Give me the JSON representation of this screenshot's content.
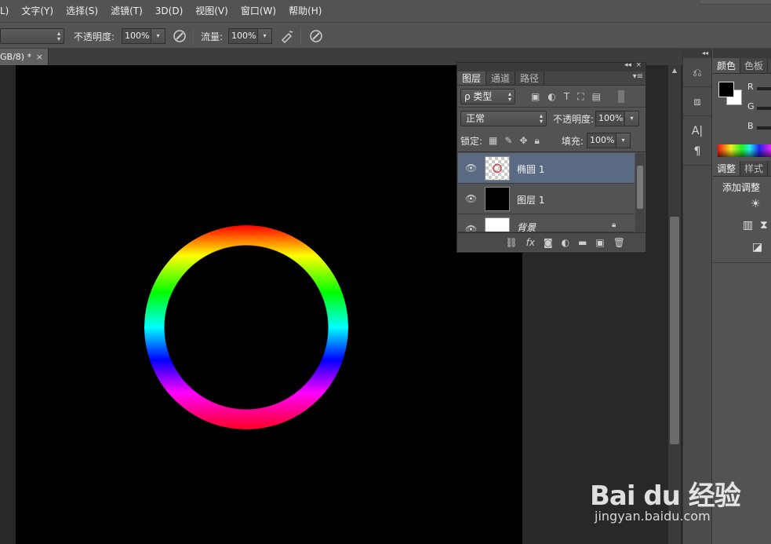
{
  "menu": {
    "items": [
      "L)",
      "文字(Y)",
      "选择(S)",
      "滤镜(T)",
      "3D(D)",
      "视图(V)",
      "窗口(W)",
      "帮助(H)"
    ]
  },
  "options_bar": {
    "opacity_label": "不透明度:",
    "opacity_value": "100%",
    "flow_label": "流量:",
    "flow_value": "100%"
  },
  "document": {
    "tab_title": "GB/8) *",
    "close_glyph": "×"
  },
  "layers_panel": {
    "collapse_glyph": "◂◂",
    "close_glyph": "×",
    "tabs": [
      "图层",
      "通道",
      "路径"
    ],
    "active_tab": "图层",
    "filter_label": "ρ 类型",
    "blend_mode": "正常",
    "opacity_label": "不透明度:",
    "opacity_value": "100%",
    "lock_label": "锁定:",
    "fill_label": "填充:",
    "fill_value": "100%",
    "layers": [
      {
        "name": "椭圆 1",
        "selected": true
      },
      {
        "name": "图层 1",
        "selected": false
      },
      {
        "name": "背景",
        "selected": false
      }
    ],
    "bottom_icons": [
      "link-icon",
      "fx-icon",
      "mask-icon",
      "adjustment-icon",
      "group-folder-icon",
      "new-layer-icon",
      "trash-icon"
    ]
  },
  "right_panel": {
    "color_tabs": [
      "颜色",
      "色板"
    ],
    "channels": [
      "R",
      "G",
      "B"
    ],
    "adjust_tabs": [
      "调整",
      "样式"
    ],
    "add_adjustment_label": "添加调整",
    "foreground_color": "#000000",
    "background_color": "#ffffff"
  },
  "canvas": {
    "background": "#000000",
    "ring_colors": [
      "#ff0000",
      "#ffff00",
      "#00ff00",
      "#00ffff",
      "#0000ff",
      "#ff00ff"
    ]
  },
  "watermark": {
    "brand": "Bai du 经验",
    "url": "jingyan.baidu.com"
  }
}
